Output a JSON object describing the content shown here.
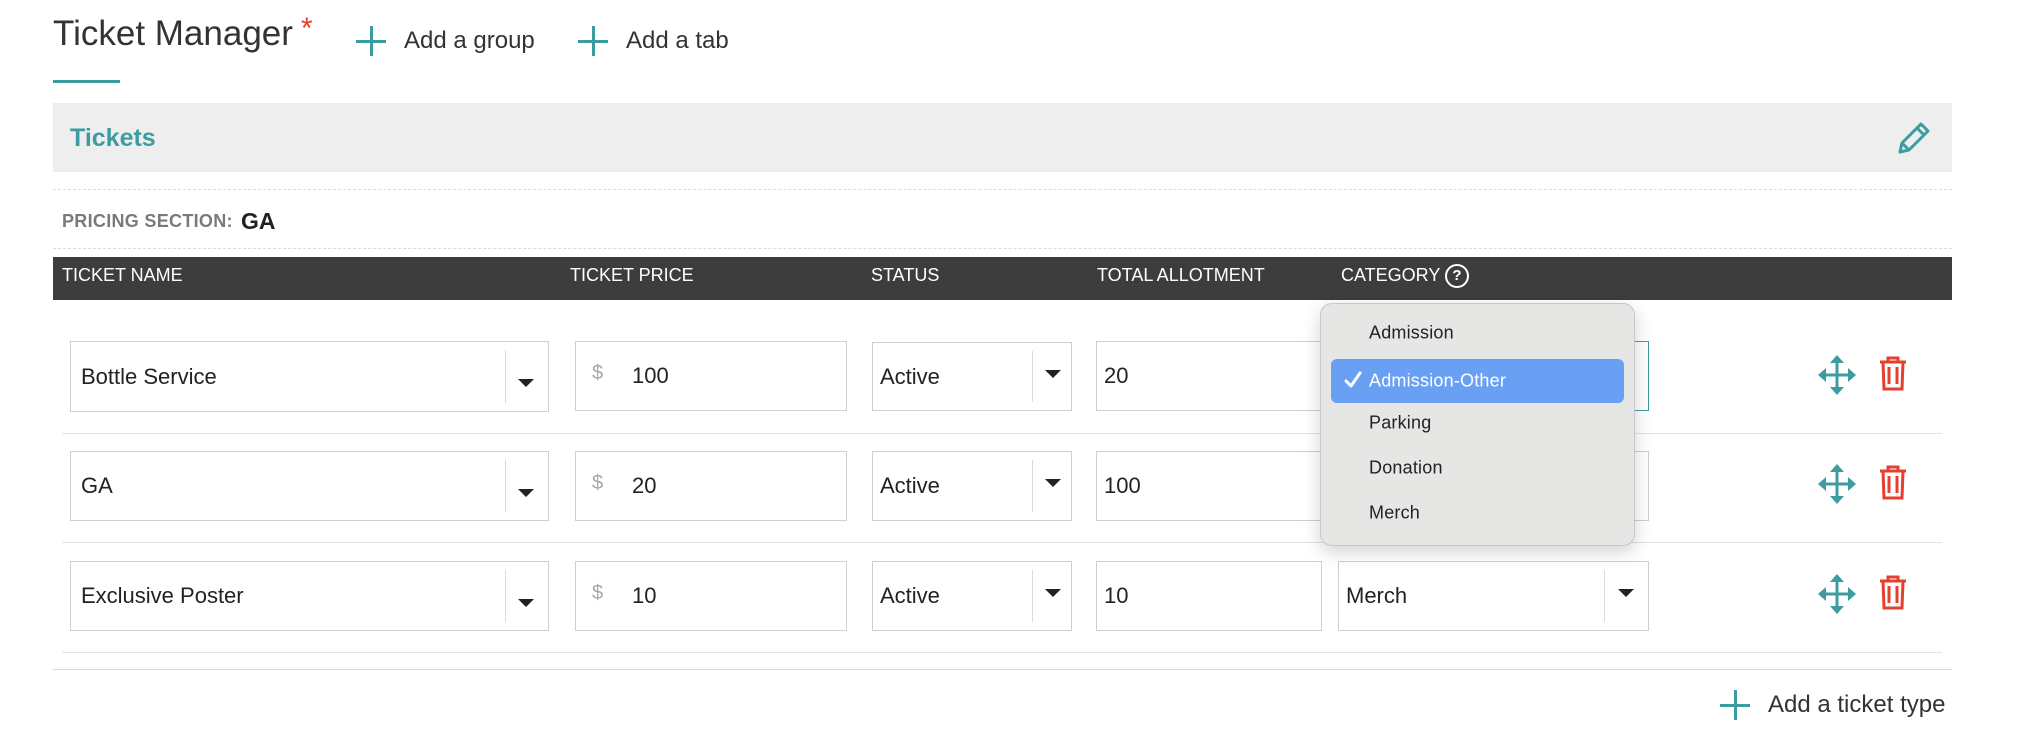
{
  "header": {
    "title": "Ticket Manager",
    "required_mark": "*",
    "add_group_label": "Add a group",
    "add_tab_label": "Add a tab"
  },
  "group": {
    "name": "Tickets"
  },
  "pricing_section": {
    "label": "PRICING SECTION:",
    "value": "GA"
  },
  "table": {
    "columns": {
      "ticket_name": "TICKET NAME",
      "ticket_price": "TICKET PRICE",
      "status": "STATUS",
      "total_allotment": "TOTAL ALLOTMENT",
      "category": "CATEGORY",
      "help_glyph": "?"
    },
    "currency_symbol": "$",
    "rows": [
      {
        "name": "Bottle Service",
        "price": "100",
        "status": "Active",
        "allotment": "20",
        "category": ""
      },
      {
        "name": "GA",
        "price": "20",
        "status": "Active",
        "allotment": "100",
        "category": ""
      },
      {
        "name": "Exclusive Poster",
        "price": "10",
        "status": "Active",
        "allotment": "10",
        "category": "Merch"
      }
    ]
  },
  "category_menu": {
    "options": [
      "Admission",
      "Admission-Other",
      "Parking",
      "Donation",
      "Merch"
    ],
    "selected": "Admission-Other"
  },
  "footer": {
    "add_ticket_label": "Add a ticket type"
  },
  "colors": {
    "accent": "#3c9ca0",
    "danger": "#e5402f",
    "header_bg": "#3d3d3d",
    "menu_selected": "#6aa0f4"
  },
  "icons": [
    "plus-icon",
    "pencil-icon",
    "help-icon",
    "chevron-down-icon",
    "move-icon",
    "trash-icon",
    "checkmark-icon"
  ]
}
